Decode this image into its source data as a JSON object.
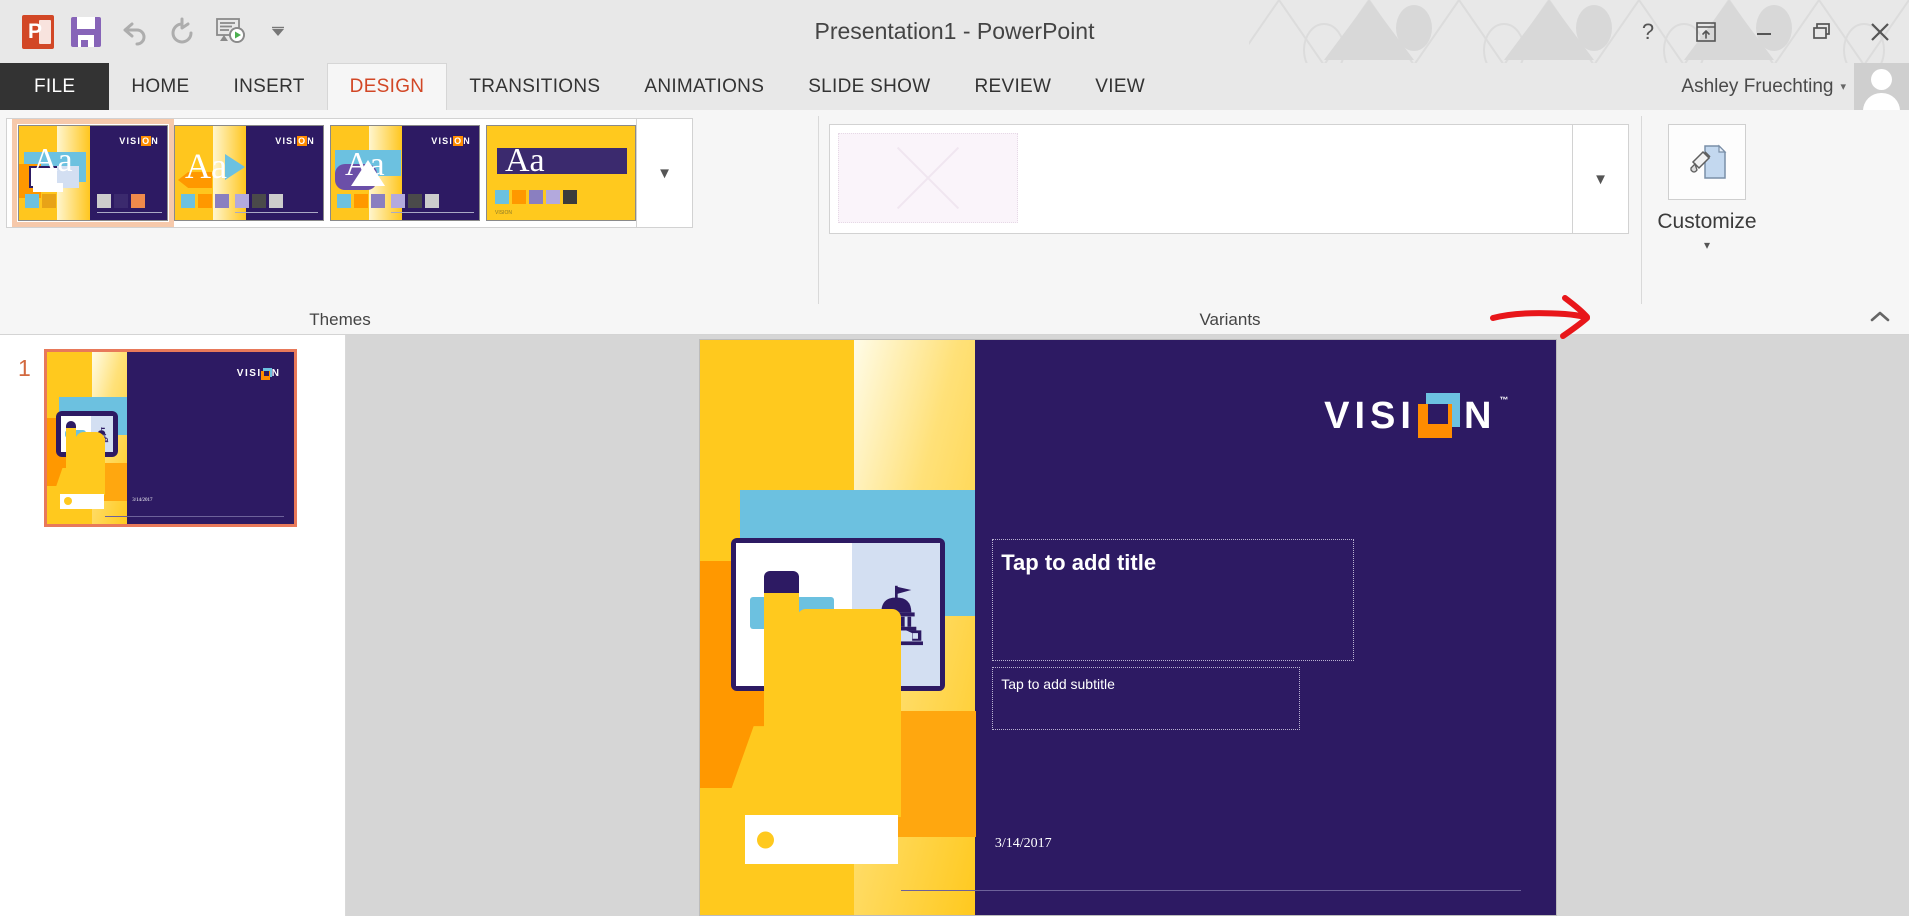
{
  "window": {
    "title": "Presentation1 - PowerPoint",
    "help_icon": "question-mark-icon",
    "ribbon_display_icon": "ribbon-display-options-icon",
    "minimize_icon": "minimize-icon",
    "restore_icon": "restore-icon",
    "close_icon": "close-icon"
  },
  "quick_access": {
    "app_logo": "powerpoint-logo-icon",
    "save": "save-icon",
    "undo": "undo-icon",
    "redo": "redo-icon",
    "start_slideshow": "start-slideshow-icon",
    "customize_qat": "customize-quick-access-toolbar-icon"
  },
  "account": {
    "name": "Ashley Fruechting",
    "caret": "▾",
    "avatar": "user-avatar-icon"
  },
  "tabs": [
    {
      "label": "FILE",
      "active": false,
      "is_file": true
    },
    {
      "label": "HOME",
      "active": false,
      "is_file": false
    },
    {
      "label": "INSERT",
      "active": false,
      "is_file": false
    },
    {
      "label": "DESIGN",
      "active": true,
      "is_file": false
    },
    {
      "label": "TRANSITIONS",
      "active": false,
      "is_file": false
    },
    {
      "label": "ANIMATIONS",
      "active": false,
      "is_file": false
    },
    {
      "label": "SLIDE SHOW",
      "active": false,
      "is_file": false
    },
    {
      "label": "REVIEW",
      "active": false,
      "is_file": false
    },
    {
      "label": "VIEW",
      "active": false,
      "is_file": false
    }
  ],
  "ribbon": {
    "groups": {
      "themes": {
        "label": "Themes",
        "more_caret": "▼",
        "thumbnails": [
          {
            "name": "Vision theme variant 1",
            "aa": "Aa",
            "selected": true,
            "swatches_left": [
              "#6cc1e0",
              "#e8a317"
            ],
            "swatches_right": [
              "#cccccc",
              "#3b2a6e",
              "#f08a4b"
            ]
          },
          {
            "name": "Vision theme variant 2",
            "aa": "Aa",
            "selected": false,
            "swatches_left": [
              "#6cc1e0",
              "#ff9800"
            ],
            "swatches_right": [
              "#8a7fc0",
              "#b3a9dd",
              "#4a4a4a",
              "#cccccc"
            ]
          },
          {
            "name": "Vision theme variant 3",
            "aa": "Aa",
            "selected": false,
            "swatches_left": [
              "#6cc1e0",
              "#ff9800"
            ],
            "swatches_right": [
              "#8a7fc0",
              "#b3a9dd",
              "#4a4a4a",
              "#cccccc"
            ]
          },
          {
            "name": "Vision theme variant 4",
            "aa": "Aa",
            "selected": false,
            "swatches_left": [
              "#6cc1e0",
              "#ff9800",
              "#8a7fc0",
              "#b3a9dd",
              "#3b3b3b"
            ],
            "swatches_right": []
          }
        ],
        "logo_text": "VISION"
      },
      "variants": {
        "label": "Variants",
        "more_caret": "▼",
        "missing_thumbnail": "missing-image-placeholder"
      },
      "customize": {
        "label": "Customize",
        "icon": "format-background-icon",
        "caret": "▾"
      }
    },
    "collapse_icon": "˄",
    "annotation": {
      "type": "red-arrow",
      "color": "#e8161a",
      "points_to": "variants-more-caret"
    }
  },
  "slide_panel": {
    "slides": [
      {
        "number": "1",
        "selected": true
      }
    ]
  },
  "slide": {
    "logo_text": "VISION",
    "logo_trademark": "™",
    "title_placeholder": "Tap to add title",
    "subtitle_placeholder": "Tap to add subtitle",
    "date": "3/14/2017",
    "illustration": "tablet-with-capitol-building-and-hand-icon",
    "colors": {
      "purple": "#2d1a63",
      "yellow": "#ffc91e",
      "orange": "#ff9800",
      "blue": "#6cc1e0"
    }
  }
}
